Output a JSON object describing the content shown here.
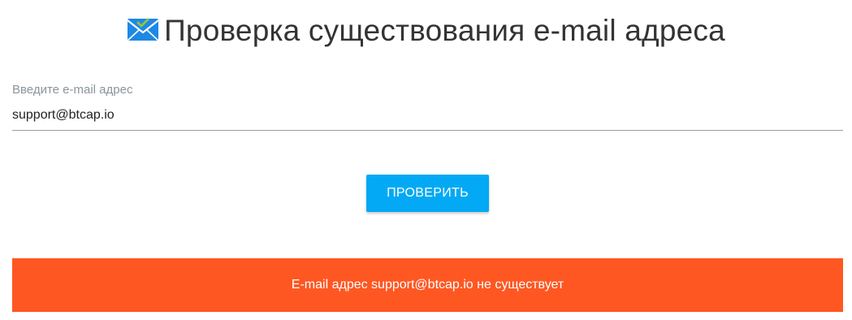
{
  "header": {
    "icon": "envelope-check-icon",
    "title": "Проверка существования e-mail адреса"
  },
  "form": {
    "email_label": "Введите e-mail адрес",
    "email_value": "support@btcap.io",
    "submit_label": "ПРОВЕРИТЬ"
  },
  "result": {
    "message": "E-mail адрес support@btcap.io не существует"
  },
  "colors": {
    "button": "#03a9f4",
    "alert": "#ff5722",
    "icon_blue": "#1e88e5",
    "icon_check": "#8bc34a"
  }
}
